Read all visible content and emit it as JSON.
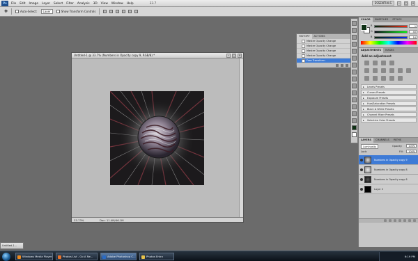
{
  "app": {
    "logo": "Ps",
    "menus": [
      "File",
      "Edit",
      "Image",
      "Layer",
      "Select",
      "Filter",
      "Analysis",
      "3D",
      "View",
      "Window",
      "Help"
    ],
    "zoom_indicator": "33.7",
    "workspace": "ESSENTIALS"
  },
  "options": {
    "auto_select_label": "Auto-Select:",
    "auto_select_value": "Layer",
    "show_transform_label": "Show Transform Controls"
  },
  "document": {
    "title": "Untitled-1 @ 33.7% (Numbers in Opacity copy 9, RGB/8) *",
    "zoom": "33.73%",
    "doc_size": "Doc: 11.4M/46.1M"
  },
  "history": {
    "tabs": [
      "HISTORY",
      "ACTIONS"
    ],
    "items": [
      "Master Opacity Change",
      "Master Opacity Change",
      "Master Opacity Change",
      "Master Opacity Change",
      "Free Transform"
    ],
    "selected_index": 4
  },
  "color_panel": {
    "tabs": [
      "COLOR",
      "SWATCHES",
      "STYLES"
    ],
    "channels": [
      {
        "label": "R",
        "value": "1"
      },
      {
        "label": "G",
        "value": "40"
      },
      {
        "label": "B",
        "value": "16"
      }
    ],
    "foreground": "#0e3014",
    "background": "#ffffff"
  },
  "adjustments": {
    "tabs": [
      "ADJUSTMENTS",
      "MASKS"
    ],
    "title": "Add an adjustment",
    "presets": [
      "Levels Presets",
      "Curves Presets",
      "Exposure Presets",
      "Hue/Saturation Presets",
      "Black & White Presets",
      "Channel Mixer Presets",
      "Selective Color Presets"
    ]
  },
  "layers": {
    "tabs": [
      "LAYERS",
      "CHANNELS",
      "PATHS"
    ],
    "blend_mode": "Luminosity",
    "opacity_label": "Opacity:",
    "opacity": "100%",
    "lock_label": "Lock:",
    "fill_label": "Fill:",
    "fill": "100%",
    "items": [
      "Numbers in Opacity copy 9",
      "Numbers in Opacity copy 8",
      "Numbers in Opacity copy 6",
      "Layer 2"
    ],
    "selected_index": 0
  },
  "minimized": {
    "title": "Untitled-1..."
  },
  "taskbar": {
    "tasks": [
      {
        "label": "Windows Media Player",
        "color": "#f08a1c"
      },
      {
        "label": "Photos List - Go A Ne...",
        "color": "#e8732a"
      },
      {
        "label": "Adobe Photoshop C...",
        "color": "#2a6bc4"
      },
      {
        "label": "Photos Entry",
        "color": "#e8c24a"
      }
    ],
    "active_index": 2,
    "clock": "6:19 PM"
  }
}
